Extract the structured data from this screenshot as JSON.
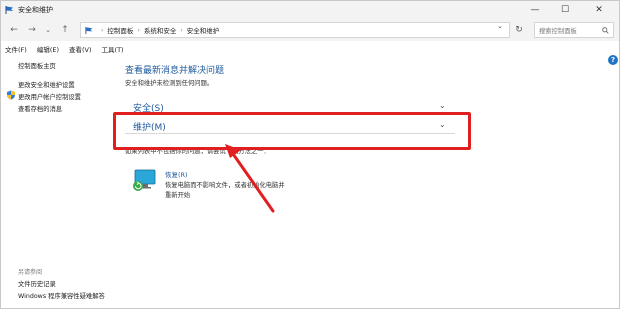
{
  "window": {
    "title": "安全和维护",
    "controls": {
      "minimize": "—",
      "maximize": "☐",
      "close": "✕"
    }
  },
  "nav": {
    "back": "←",
    "forward": "→",
    "recent": "⌄",
    "up": "↑",
    "breadcrumbs": [
      "控制面板",
      "系统和安全",
      "安全和维护"
    ],
    "refresh": "↻",
    "search_placeholder": "搜索控制面板"
  },
  "menu": [
    "文件(F)",
    "编辑(E)",
    "查看(V)",
    "工具(T)"
  ],
  "left_panel": {
    "links": [
      "控制面板主页",
      "更改安全和维护设置",
      "更改用户帐户控制设置",
      "查看存档的消息"
    ],
    "see_also_title": "另请参阅",
    "see_also_links": [
      "文件历史记录",
      "Windows 程序兼容性疑难解答"
    ]
  },
  "main": {
    "title": "查看最新消息并解决问题",
    "subtitle": "安全和维护未检测到任何问题。",
    "sections": [
      {
        "label": "安全(S)",
        "expanded": false
      },
      {
        "label": "维护(M)",
        "expanded": false
      }
    ],
    "note": "如果列表中不包括你的问题，请尝试下列方法之一：",
    "recovery": {
      "title": "恢复(R)",
      "description": "恢复电脑而不影响文件，或者初始化电脑并重新开始"
    }
  },
  "help": "?",
  "colors": {
    "accent": "#1e5a9c",
    "annotation": "#e02020"
  }
}
